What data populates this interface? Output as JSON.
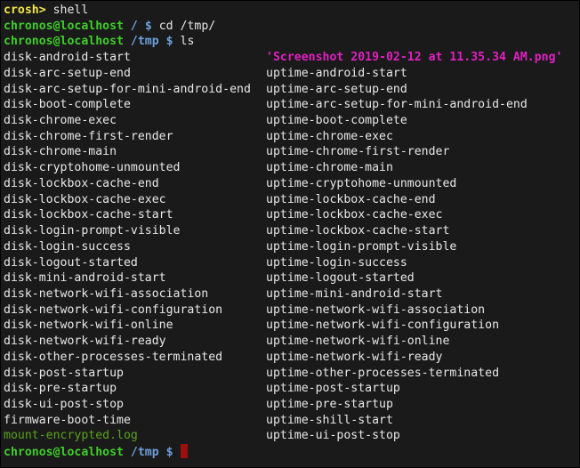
{
  "terminal": {
    "prompt_crosh": "crosh>",
    "cmd_shell": " shell",
    "user_host": "chronos@localhost",
    "lines": [
      {
        "dir": " /",
        "sym": " $",
        "cmd": " cd /tmp/"
      },
      {
        "dir": " /tmp",
        "sym": " $",
        "cmd": " ls"
      }
    ],
    "final_prompt": {
      "dir": " /tmp",
      "sym": " $",
      "cmd": " "
    },
    "ls_left": [
      "disk-android-start",
      "disk-arc-setup-end",
      "disk-arc-setup-for-mini-android-end",
      "disk-boot-complete",
      "disk-chrome-exec",
      "disk-chrome-first-render",
      "disk-chrome-main",
      "disk-cryptohome-unmounted",
      "disk-lockbox-cache-end",
      "disk-lockbox-cache-exec",
      "disk-lockbox-cache-start",
      "disk-login-prompt-visible",
      "disk-login-success",
      "disk-logout-started",
      "disk-mini-android-start",
      "disk-network-wifi-association",
      "disk-network-wifi-configuration",
      "disk-network-wifi-online",
      "disk-network-wifi-ready",
      "disk-other-processes-terminated",
      "disk-post-startup",
      "disk-pre-startup",
      "disk-ui-post-stop",
      "firmware-boot-time",
      "mount-encrypted.log"
    ],
    "ls_right": [
      "'Screenshot 2019-02-12 at 11.35.34 AM.png'",
      "uptime-android-start",
      "uptime-arc-setup-end",
      "uptime-arc-setup-for-mini-android-end",
      "uptime-boot-complete",
      "uptime-chrome-exec",
      "uptime-chrome-first-render",
      "uptime-chrome-main",
      "uptime-cryptohome-unmounted",
      "uptime-lockbox-cache-end",
      "uptime-lockbox-cache-exec",
      "uptime-lockbox-cache-start",
      "uptime-login-prompt-visible",
      "uptime-login-success",
      "uptime-logout-started",
      "uptime-mini-android-start",
      "uptime-network-wifi-association",
      "uptime-network-wifi-configuration",
      "uptime-network-wifi-online",
      "uptime-network-wifi-ready",
      "uptime-other-processes-terminated",
      "uptime-post-startup",
      "uptime-pre-startup",
      "uptime-shill-start",
      "uptime-ui-post-stop"
    ],
    "colors": {
      "background": "#1a1a1a",
      "text": "#e8e8e8",
      "crosh_prompt": "#f4e64a",
      "user_host": "#3fce2a",
      "path": "#6d9fdb",
      "image_file": "#e020c0",
      "log_file": "#5aa21c",
      "cursor": "#9c0f0f"
    }
  }
}
